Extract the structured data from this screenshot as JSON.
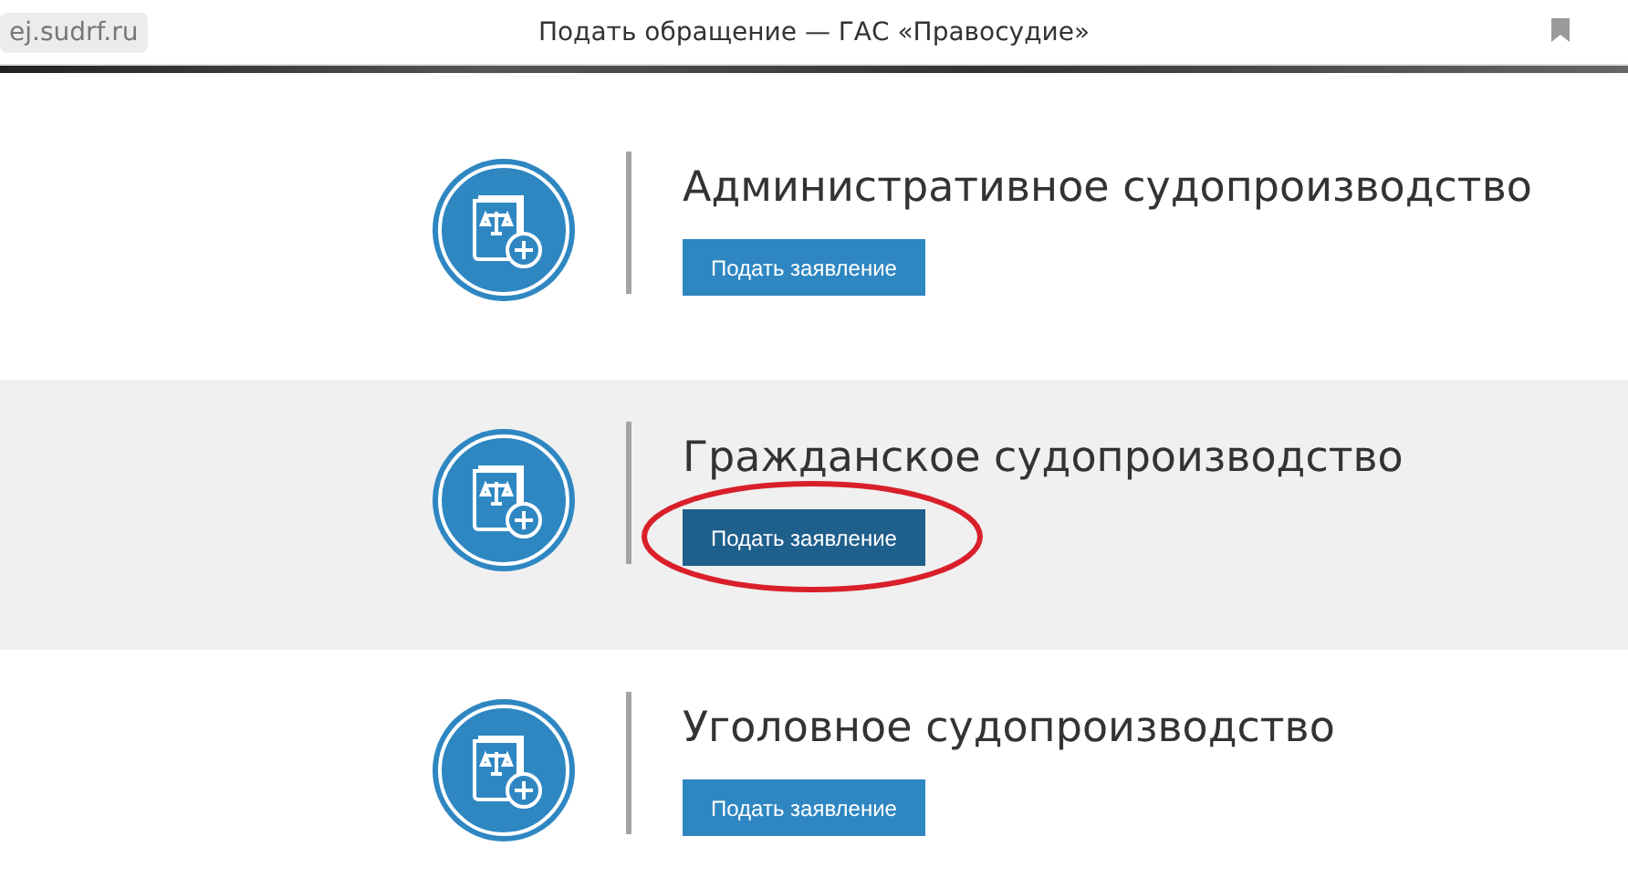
{
  "browser": {
    "address": "ej.sudrf.ru",
    "title": "Подать обращение — ГАС «Правосудие»"
  },
  "sections": [
    {
      "title": "Административное судопроизводство",
      "button": "Подать заявление",
      "selected": false
    },
    {
      "title": "Гражданское судопроизводство",
      "button": "Подать заявление",
      "selected": true
    },
    {
      "title": "Уголовное судопроизводство",
      "button": "Подать заявление",
      "selected": false
    }
  ]
}
